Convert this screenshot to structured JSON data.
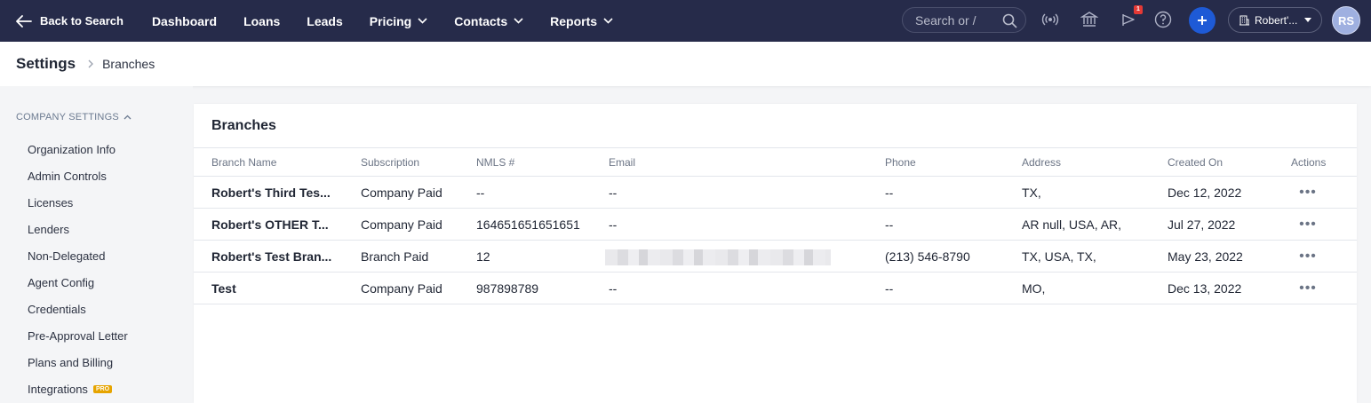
{
  "nav": {
    "back_label": "Back to Search",
    "links": [
      {
        "label": "Dashboard",
        "has_menu": false
      },
      {
        "label": "Loans",
        "has_menu": false
      },
      {
        "label": "Leads",
        "has_menu": false
      },
      {
        "label": "Pricing",
        "has_menu": true
      },
      {
        "label": "Contacts",
        "has_menu": true
      },
      {
        "label": "Reports",
        "has_menu": true
      }
    ],
    "search_placeholder": "Search or /",
    "notification_count": "1",
    "org_label": "Robert'...",
    "avatar_initials": "RS",
    "icons": [
      "broadcast-icon",
      "bank-icon",
      "announcement-icon",
      "help-icon",
      "plus-icon",
      "building-icon"
    ]
  },
  "breadcrumb": {
    "root": "Settings",
    "current": "Branches"
  },
  "sidebar": {
    "section_title": "COMPANY SETTINGS",
    "items": [
      {
        "label": "Organization Info"
      },
      {
        "label": "Admin Controls"
      },
      {
        "label": "Licenses"
      },
      {
        "label": "Lenders"
      },
      {
        "label": "Non-Delegated"
      },
      {
        "label": "Agent Config"
      },
      {
        "label": "Credentials"
      },
      {
        "label": "Pre-Approval Letter"
      },
      {
        "label": "Plans and Billing"
      },
      {
        "label": "Integrations",
        "badge": "PRO"
      }
    ]
  },
  "main": {
    "title": "Branches",
    "columns": [
      "Branch Name",
      "Subscription",
      "NMLS #",
      "Email",
      "Phone",
      "Address",
      "Created On",
      "Actions"
    ],
    "rows": [
      {
        "name": "Robert's Third Tes...",
        "subscription": "Company Paid",
        "nmls": "--",
        "email": "--",
        "phone": "--",
        "address": "TX,",
        "created": "Dec 12, 2022"
      },
      {
        "name": "Robert's OTHER T...",
        "subscription": "Company Paid",
        "nmls": "164651651651651",
        "email": "--",
        "phone": "--",
        "address": "AR null, USA, AR,",
        "created": "Jul 27, 2022"
      },
      {
        "name": "Robert's Test Bran...",
        "subscription": "Branch Paid",
        "nmls": "12",
        "email": "",
        "phone": "(213) 546-8790",
        "address": "TX, USA, TX,",
        "created": "May 23, 2022"
      },
      {
        "name": "Test",
        "subscription": "Company Paid",
        "nmls": "987898789",
        "email": "--",
        "phone": "--",
        "address": "MO,",
        "created": "Dec 13, 2022"
      }
    ],
    "actions_glyph": "•••"
  },
  "colors": {
    "nav_bg": "#262b4a",
    "accent": "#1e5ad6",
    "badge_red": "#e53935",
    "pro_badge": "#e6a400"
  }
}
